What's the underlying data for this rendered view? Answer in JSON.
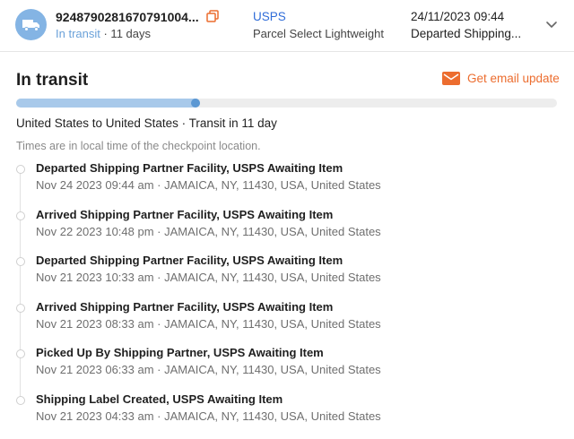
{
  "header": {
    "avatar_icon": "delivery-truck-icon",
    "tracking_number": "9248790281670791004...",
    "copy_icon": "copy-icon",
    "status": "In transit",
    "status_suffix": "· 11 days",
    "carrier": "USPS",
    "service": "Parcel Select Lightweight",
    "last_date": "24/11/2023 09:44",
    "last_event": "Departed Shipping...",
    "expand_icon": "chevron-down-icon"
  },
  "panel": {
    "title": "In transit",
    "email_icon": "envelope-icon",
    "email_label": "Get email update",
    "progress": 0.34,
    "route": "United States to United States · Transit in 11 day",
    "note": "Times are in local time of the checkpoint location."
  },
  "events": [
    {
      "title": "Departed Shipping Partner Facility, USPS Awaiting Item",
      "detail": "Nov 24 2023 09:44 am · JAMAICA, NY, 11430, USA, United States"
    },
    {
      "title": "Arrived Shipping Partner Facility, USPS Awaiting Item",
      "detail": "Nov 22 2023 10:48 pm · JAMAICA, NY, 11430, USA, United States"
    },
    {
      "title": "Departed Shipping Partner Facility, USPS Awaiting Item",
      "detail": "Nov 21 2023 10:33 am · JAMAICA, NY, 11430, USA, United States"
    },
    {
      "title": "Arrived Shipping Partner Facility, USPS Awaiting Item",
      "detail": "Nov 21 2023 08:33 am · JAMAICA, NY, 11430, USA, United States"
    },
    {
      "title": "Picked Up By Shipping Partner, USPS Awaiting Item",
      "detail": "Nov 21 2023 06:33 am · JAMAICA, NY, 11430, USA, United States"
    },
    {
      "title": "Shipping Label Created, USPS Awaiting Item",
      "detail": "Nov 21 2023 04:33 am · JAMAICA, NY, 11430, USA, United States"
    }
  ],
  "colors": {
    "accent_blue": "#2f6cd8",
    "status_blue": "#6aa1d9",
    "progress_fill": "#a8c9ea",
    "progress_knob": "#5c98d3",
    "email_orange": "#ec6d2f"
  }
}
